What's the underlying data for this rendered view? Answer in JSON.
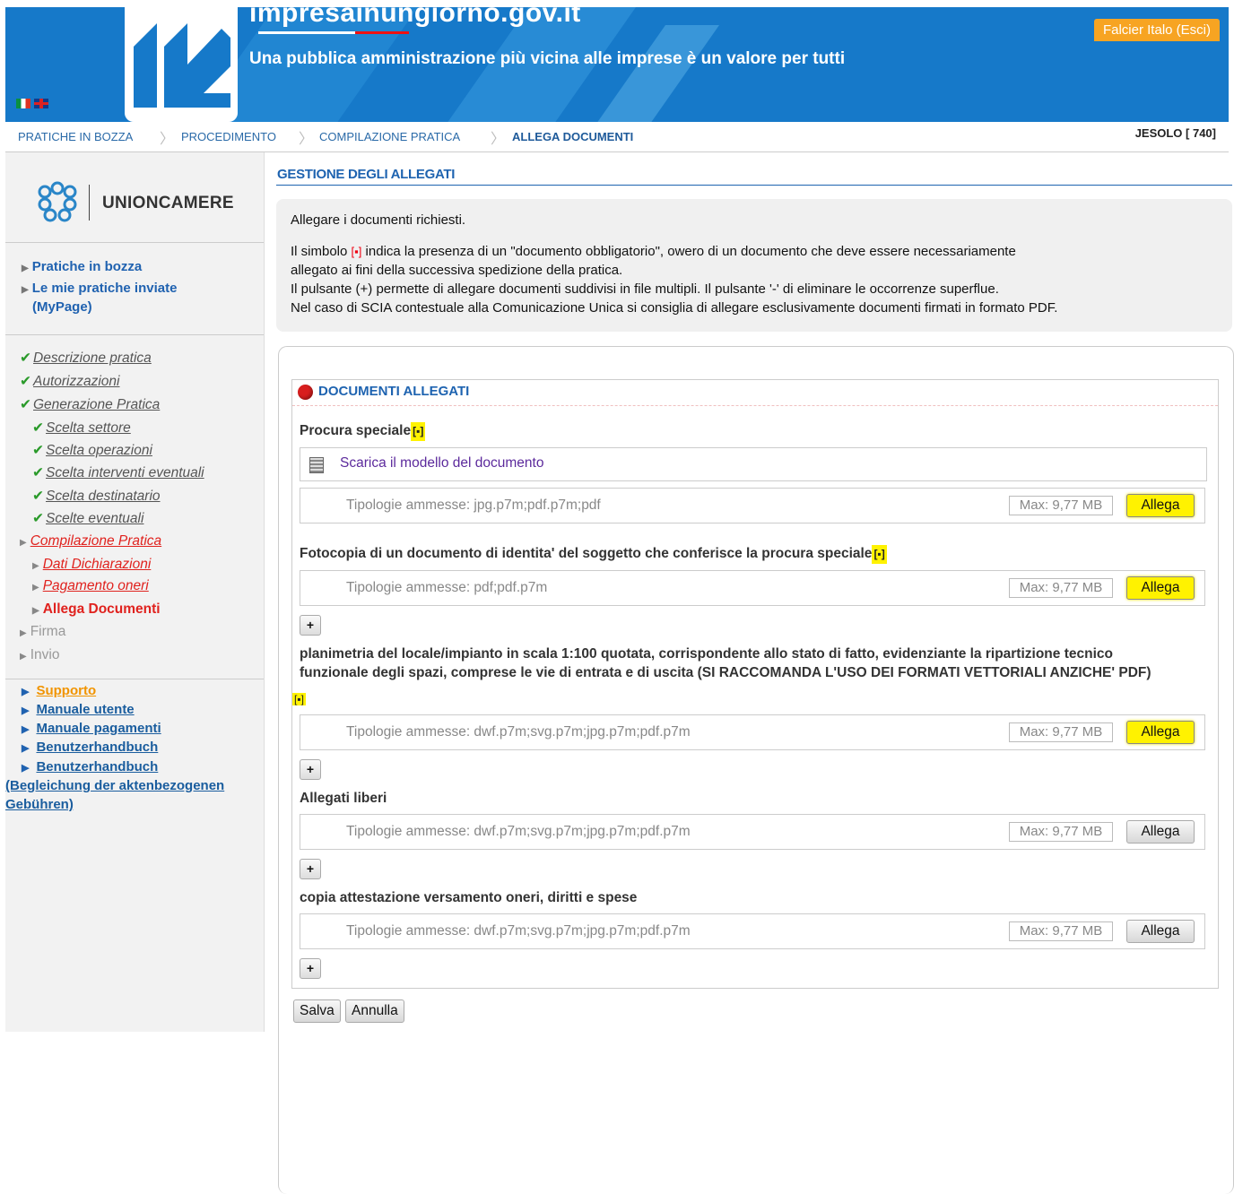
{
  "header": {
    "site_title": "impresainungiorno.gov.it",
    "slogan": "Una pubblica amministrazione più vicina alle imprese è un valore per tutti",
    "user_button": "Falcier Italo (Esci)",
    "accent_color": "#1679c9",
    "user_button_color": "#f7a422"
  },
  "breadcrumb": {
    "items": [
      "PRATICHE IN BOZZA",
      "PROCEDIMENTO",
      "COMPILAZIONE PRATICA",
      "ALLEGA DOCUMENTI"
    ],
    "location": "JESOLO [ 740]"
  },
  "sidebar": {
    "org_name": "UNIONCAMERE",
    "links": [
      "Pratiche in bozza",
      "Le mie pratiche inviate",
      "(MyPage)"
    ],
    "steps": [
      "Descrizione pratica",
      "Autorizzazioni",
      "Generazione Pratica",
      "Scelta settore",
      "Scelta operazioni",
      "Scelta interventi eventuali",
      "Scelta destinatario",
      "Scelte eventuali",
      "Compilazione Pratica",
      "Dati Dichiarazioni",
      "Pagamento oneri",
      "Allega Documenti",
      "Firma",
      "Invio"
    ],
    "support": [
      "Supporto",
      "Manuale utente",
      "Manuale pagamenti",
      "Benutzerhandbuch",
      "Benutzerhandbuch",
      "(Begleichung der aktenbezogenen",
      "Gebühren)"
    ]
  },
  "main": {
    "section_title": "GESTIONE DEGLI ALLEGATI",
    "info_intro": "Allegare i documenti richiesti.",
    "info_line1a": "Il simbolo",
    "info_line1b": "indica la presenza di un \"documento obbligatorio\", owero di un documento che deve essere necessariamente",
    "info_line2": "allegato ai fini della successiva spedizione della pratica.",
    "info_line3": "Il pulsante (+) permette di allegare documenti suddivisi in file multipli. Il pulsante '-' di eliminare le occorrenze superflue.",
    "info_line4": "Nel caso di SCIA contestuale alla Comunicazione Unica si consiglia di allegare esclusivamente documenti firmati in formato PDF.",
    "required_symbol": "[▪]",
    "docs_title": "DOCUMENTI ALLEGATI",
    "download_label": "Scarica il modello del documento",
    "max_size": "Max: 9,77 MB",
    "attach_label": "Allega",
    "plus_label": "+",
    "documents": [
      {
        "label": "Procura speciale",
        "types": "Tipologie ammesse: jpg.p7m;pdf.p7m;pdf"
      },
      {
        "label": "Fotocopia di un documento di identita' del soggetto che conferisce la procura speciale",
        "types": "Tipologie ammesse: pdf;pdf.p7m"
      },
      {
        "label_line1": "planimetria del locale/impianto in scala 1:100 quotata, corrispondente allo stato di fatto, evidenziante la ripartizione tecnico",
        "label_line2": "funzionale degli spazi, comprese le vie di entrata e di uscita (SI RACCOMANDA L'USO DEI FORMATI VETTORIALI ANZICHE' PDF)",
        "types": "Tipologie ammesse: dwf.p7m;svg.p7m;jpg.p7m;pdf.p7m"
      },
      {
        "label": "Allegati liberi",
        "types": "Tipologie ammesse: dwf.p7m;svg.p7m;jpg.p7m;pdf.p7m"
      },
      {
        "label": "copia attestazione versamento oneri, diritti e spese",
        "types": "Tipologie ammesse: dwf.p7m;svg.p7m;jpg.p7m;pdf.p7m"
      }
    ],
    "save_label": "Salva",
    "cancel_label": "Annulla"
  }
}
